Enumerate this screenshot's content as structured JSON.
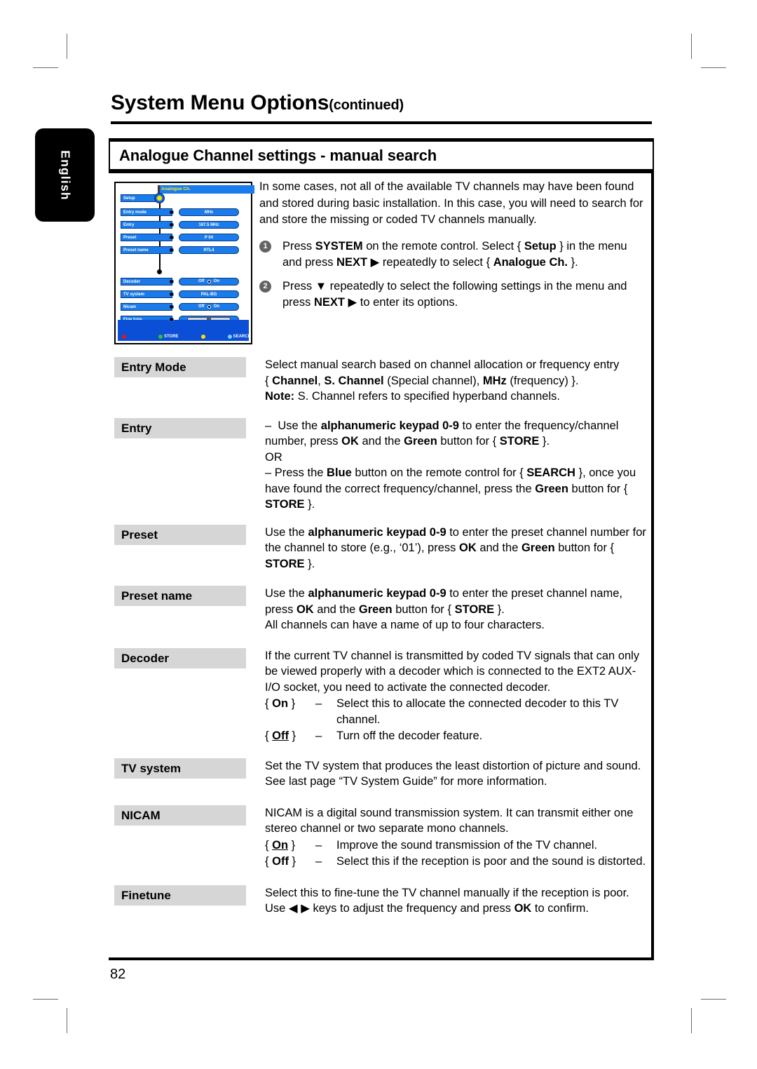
{
  "page": {
    "title_main": "System Menu Options",
    "title_continued": "(continued)",
    "section_title": "Analogue Channel settings - manual search",
    "language_tab": "English",
    "page_number": "82"
  },
  "tv_screen": {
    "menu_title": "Analogue Ch.",
    "parent_item": "Setup",
    "rows": [
      {
        "label": "Entry mode",
        "value": "MHz"
      },
      {
        "label": "Entry",
        "value": "167.5 MHz"
      },
      {
        "label": "Preset",
        "value": "P 04"
      },
      {
        "label": "Preset name",
        "value": "RTL4"
      }
    ],
    "rows2": [
      {
        "label": "Decoder",
        "value_off": "Off",
        "value_on": "On"
      },
      {
        "label": "TV system",
        "value": "PAL-BG"
      },
      {
        "label": "Nicam",
        "value_off": "Off",
        "value_on": "On"
      },
      {
        "label": "Fine tune",
        "value": ""
      }
    ],
    "buttons": [
      {
        "color": "#ee1111",
        "label": ""
      },
      {
        "color": "#22cc22",
        "label": "STORE"
      },
      {
        "color": "#ffdd00",
        "label": ""
      },
      {
        "color": "#66ddff",
        "label": "SEARCH"
      }
    ]
  },
  "intro": {
    "paragraph": "In some cases, not all of the available TV channels may have been found and stored during basic installation. In this case, you will need to search for and store the missing or coded TV channels manually.",
    "steps": [
      {
        "num": "1",
        "text_html": "Press <b>SYSTEM</b> on the remote control. Select { <b>Setup</b> } in the menu and press <b>NEXT</b> ▶ repeatedly to select { <b>Analogue Ch.</b> }."
      },
      {
        "num": "2",
        "text_html": "Press ▼ repeatedly to select the following settings in the menu and press <b>NEXT</b> ▶ to enter its options."
      }
    ]
  },
  "settings": [
    {
      "term": "Entry Mode",
      "body_html": "Select manual search based on channel allocation or frequency entry<br>{ <b>Channel</b>, <b>S. Channel</b> (Special channel), <b>MHz</b> (frequency) }.<br><b>Note:</b> S. Channel refers to specified hyperband channels."
    },
    {
      "term": "Entry",
      "body_html": "&ndash;&nbsp; Use the <b>alphanumeric keypad 0-9</b> to enter the frequency/channel number, press <b>OK</b> and the <b>Green</b> button for { <b>STORE</b> }.<br>OR<br>&ndash; Press the <b>Blue</b> button on the remote control for { <b>SEARCH</b> }, once you have found the correct frequency/channel, press the <b>Green</b> button for { <b>STORE</b> }."
    },
    {
      "term": "Preset",
      "body_html": "Use the <b>alphanumeric keypad 0-9</b> to enter the preset channel number for the channel to store (e.g., ‘01’), press <b>OK</b> and the <b>Green</b> button for { <b>STORE</b> }."
    },
    {
      "term": "Preset name",
      "body_html": "Use the <b>alphanumeric keypad 0-9</b> to enter the preset channel name, press <b>OK</b> and the <b>Green</b> button for { <b>STORE</b> }.<br>All channels can have a name of up to four characters."
    },
    {
      "term": "Decoder",
      "body_html": "If the current TV channel is transmitted by coded TV signals that can only be viewed properly with a decoder which is connected to the EXT2 AUX-I/O socket, you need to activate the connected decoder.",
      "options": [
        {
          "key_html": "{ <b>On</b> }",
          "dash": "–",
          "value": "Select this to allocate the connected decoder to this TV channel."
        },
        {
          "key_html": "{ <b><u>Off</u></b> }",
          "dash": "–",
          "value": "Turn off the decoder feature."
        }
      ]
    },
    {
      "term": "TV system",
      "body_html": "Set the TV system that produces the least distortion of picture and sound. See last page “TV System Guide” for more information."
    },
    {
      "term": "NICAM",
      "body_html": "NICAM is a digital sound transmission system. It can transmit either one stereo channel or two separate mono channels.",
      "options": [
        {
          "key_html": "{ <b><u>On</u></b> }",
          "dash": "–",
          "value": "Improve the sound transmission of the TV channel."
        },
        {
          "key_html": "{ <b>Off</b> }",
          "dash": "–",
          "value": "Select this if the reception is poor and the sound is distorted."
        }
      ]
    },
    {
      "term": "Finetune",
      "body_html": "Select this to fine-tune the TV channel manually if the reception is poor. Use ◀ ▶ keys to adjust the frequency and press <b>OK</b> to confirm."
    }
  ]
}
